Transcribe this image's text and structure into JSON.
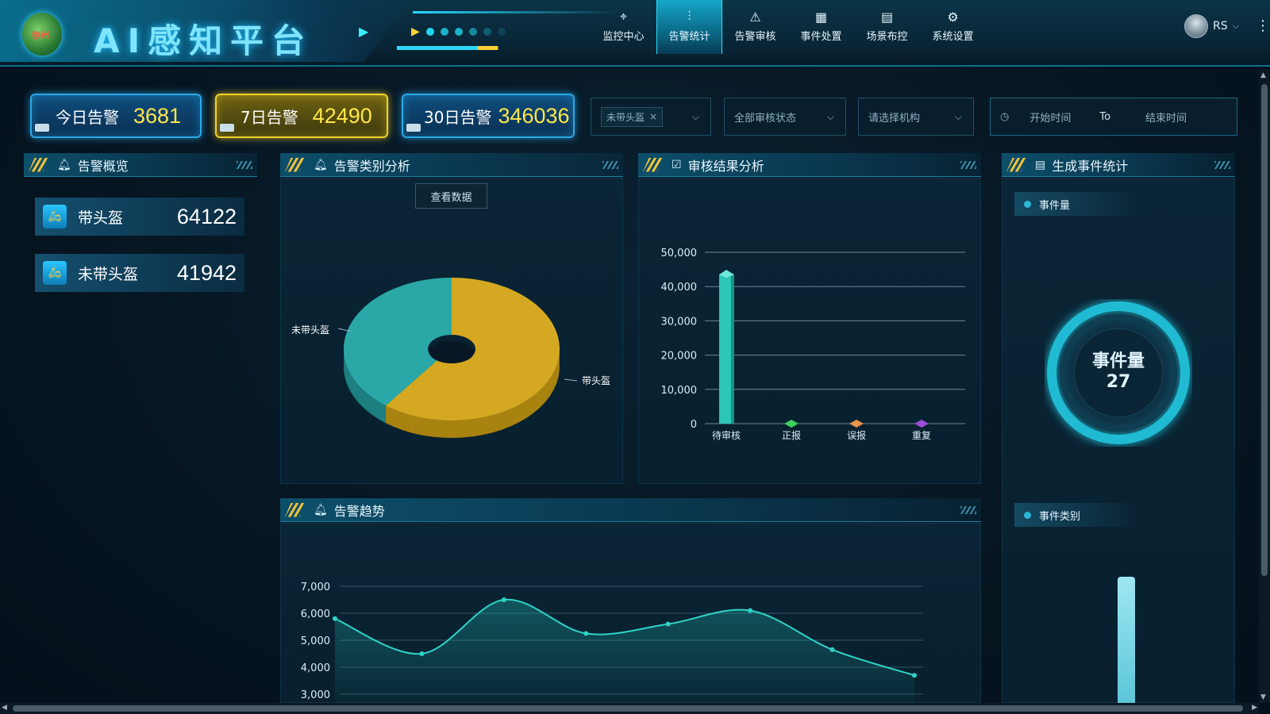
{
  "header": {
    "title": "AI感知平台",
    "logo_text": "徐州",
    "nav": [
      {
        "label": "监控中心",
        "icon": "crosshair-icon",
        "glyph": "⌖"
      },
      {
        "label": "告警统计",
        "icon": "chart-icon",
        "glyph": "⫶",
        "active": true
      },
      {
        "label": "告警审核",
        "icon": "warning-icon",
        "glyph": "⚠"
      },
      {
        "label": "事件处置",
        "icon": "calendar-icon",
        "glyph": "▦"
      },
      {
        "label": "场景布控",
        "icon": "document-icon",
        "glyph": "▤"
      },
      {
        "label": "系统设置",
        "icon": "gear-icon",
        "glyph": "⚙"
      }
    ],
    "user": "RS",
    "caret": "⌵",
    "more": "⋮"
  },
  "stats": [
    {
      "label": "今日告警",
      "value": "3681"
    },
    {
      "label": "7日告警",
      "value": "42490"
    },
    {
      "label": "30日告警",
      "value": "346036"
    }
  ],
  "filters": {
    "tag": "未带头盔",
    "tag_close": "×",
    "audit_status": "全部审核状态",
    "org": "请选择机构",
    "start": "开始时间",
    "to": "To",
    "end": "结束时间",
    "chevron": "⌵",
    "clock": "◷"
  },
  "panels": {
    "overview": "告警概览",
    "category": "告警类别分析",
    "review": "审核结果分析",
    "events": "生成事件统计",
    "trend": "告警趋势"
  },
  "overview_items": [
    {
      "label": "带头盔",
      "value": "64122"
    },
    {
      "label": "未带头盔",
      "value": "41942"
    }
  ],
  "view_data_button": "查看数据",
  "events": {
    "legend1": "事件量",
    "legend2": "事件类别",
    "ring_label": "事件量",
    "ring_value": "27"
  },
  "colors": {
    "accent": "#20d5f0",
    "yellow": "#f1d22c",
    "pie_teal": "#2aa8a8",
    "pie_gold": "#d4a820",
    "bar_teal": "#2cc6b6"
  },
  "chart_data": [
    {
      "type": "pie",
      "categories": [
        "带头盔",
        "未带头盔"
      ],
      "values": [
        64122,
        41942
      ]
    },
    {
      "type": "bar",
      "categories": [
        "待审核",
        "正报",
        "误报",
        "重复"
      ],
      "values": [
        43500,
        0,
        0,
        0
      ],
      "ylim": [
        0,
        50000
      ],
      "yticks": [
        "0",
        "10,000",
        "20,000",
        "30,000",
        "40,000",
        "50,000"
      ],
      "marker_colors": [
        "#2cc6b6",
        "#3fcf5a",
        "#e8944a",
        "#9b4fd8"
      ]
    },
    {
      "type": "area",
      "values": [
        5800,
        4500,
        6500,
        5250,
        5600,
        6100,
        4650,
        3700
      ],
      "ylim": [
        3000,
        7000
      ],
      "yticks": [
        "3,000",
        "4,000",
        "5,000",
        "6,000",
        "7,000"
      ]
    }
  ]
}
